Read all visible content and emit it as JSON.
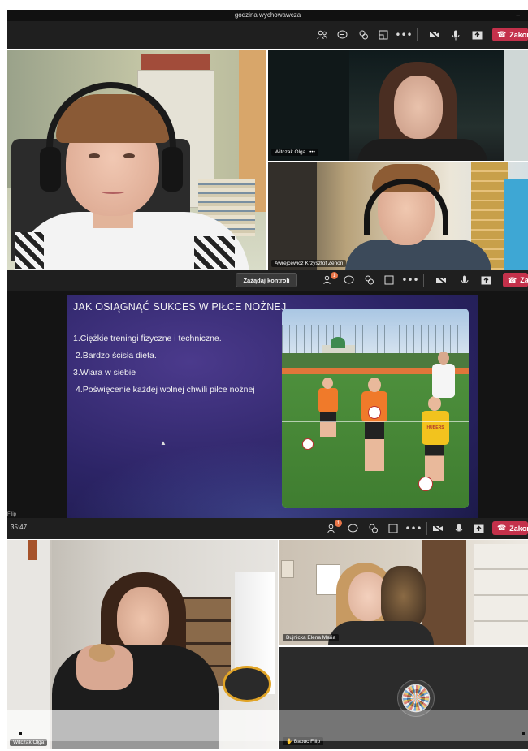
{
  "app": {
    "title": "godzina wychowawcza"
  },
  "toolbar": {
    "end_label": "Zakończ",
    "request_control_label": "Zażądaj kontroli",
    "timer": "35:47",
    "participants_badge": "1",
    "icons": [
      "people-icon",
      "chat-icon",
      "reactions-icon",
      "rooms-icon",
      "more-icon",
      "camera-off-icon",
      "mic-icon",
      "share-icon",
      "hangup-icon"
    ]
  },
  "participants": {
    "witczak_1": "Witczak Olga",
    "awrejcewicz": "Awrejcewicz Krzysztof Zenon",
    "bujnicka": "Bujnicka Elena Maria",
    "witczak_2": "Witczak Olga",
    "babuc": "Babuc Filip",
    "presenter_short": "Filip"
  },
  "slide": {
    "title": "JAK OSIĄGNĄĆ SUKCES W PIŁCE NOŻNEJ",
    "items": [
      "1.Ciężkie treningi fizyczne i techniczne.",
      "2.Bardzo ścisła dieta.",
      "3.Wiara w siebie",
      "4.Poświęcenie każdej wolnej chwili piłce nożnej"
    ],
    "photo_jersey_text": "HUBERS"
  },
  "colors": {
    "end_button": "#c4314b",
    "slide_bg_top": "#3b2d74",
    "slide_bg_bottom": "#1e1a4e",
    "bar_bg": "#1f1f1f",
    "badge": "#e97548"
  }
}
